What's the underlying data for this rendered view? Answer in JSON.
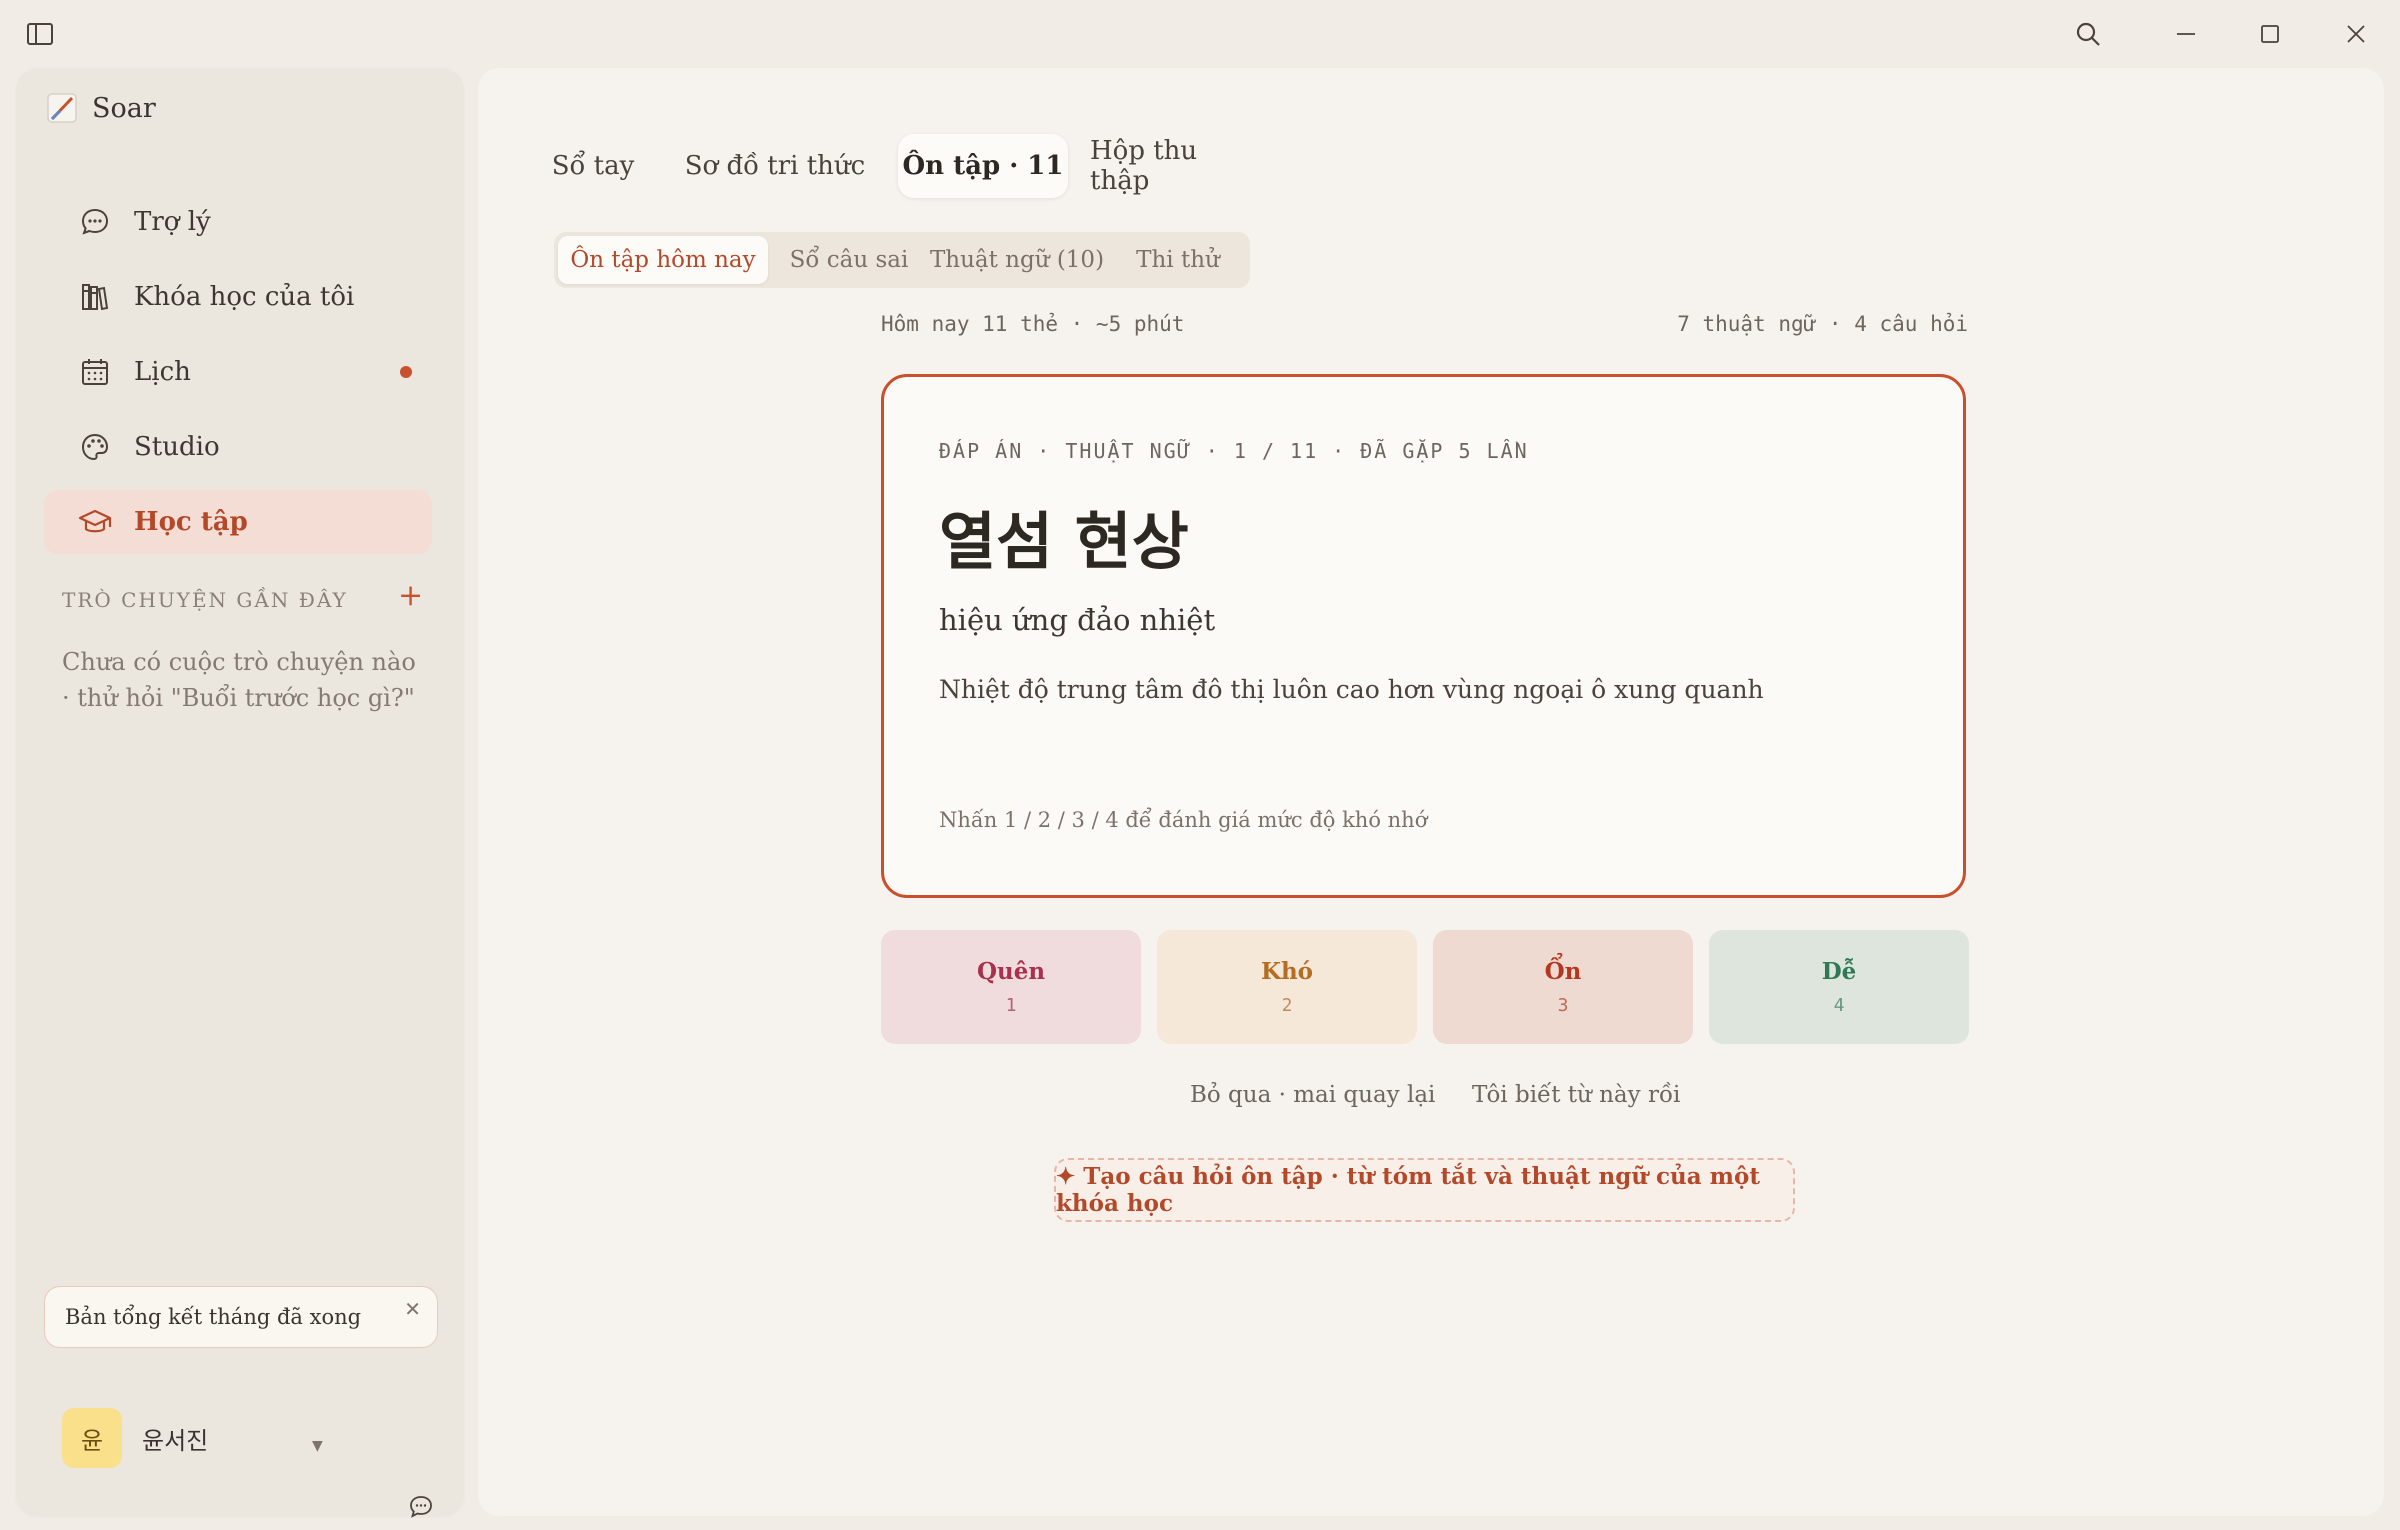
{
  "app": {
    "name": "Soar"
  },
  "sidebar": {
    "nav": [
      {
        "label": "Trợ lý",
        "icon": "chat-bubble-icon"
      },
      {
        "label": "Khóa học của tôi",
        "icon": "books-icon"
      },
      {
        "label": "Lịch",
        "icon": "calendar-icon",
        "badge": true
      },
      {
        "label": "Studio",
        "icon": "palette-icon"
      },
      {
        "label": "Học tập",
        "icon": "graduation-cap-icon",
        "active": true
      }
    ],
    "recent_heading": "TRÒ CHUYỆN GẦN ĐÂY",
    "recent_empty": "Chưa có cuộc trò chuyện nào · thử hỏi \"Buổi trước học gì?\"",
    "toast": "Bản tổng kết tháng đã xong",
    "user": {
      "avatar_text": "윤",
      "name": "윤서진"
    }
  },
  "tabs": [
    {
      "label": "Sổ tay"
    },
    {
      "label": "Sơ đồ tri thức"
    },
    {
      "label": "Ôn tập · 11",
      "active": true
    },
    {
      "label": "Hộp thu thập"
    }
  ],
  "subtabs": [
    {
      "label": "Ôn tập hôm nay",
      "active": true
    },
    {
      "label": "Sổ câu sai"
    },
    {
      "label": "Thuật ngữ (10)"
    },
    {
      "label": "Thi thử"
    }
  ],
  "review": {
    "summary_left": "Hôm nay 11 thẻ · ~5 phút",
    "summary_right": "7 thuật ngữ · 4 câu hỏi",
    "card": {
      "label": "ĐÁP ÁN · THUẬT NGỮ · 1 / 11 · ĐÃ GẶP 5 LẦN",
      "term": "열섬 현상",
      "meaning": "hiệu ứng đảo nhiệt",
      "description": "Nhiệt độ trung tâm đô thị luôn cao hơn vùng ngoại ô xung quanh",
      "hint": "Nhấn 1 / 2 / 3 / 4 để đánh giá mức độ khó nhớ"
    },
    "ratings": [
      {
        "label": "Quên",
        "key": "1",
        "bg": "#f0dcdc",
        "color": "#a8324e"
      },
      {
        "label": "Khó",
        "key": "2",
        "bg": "#f5e8d8",
        "color": "#b56d22"
      },
      {
        "label": "Ổn",
        "key": "3",
        "bg": "#eedad0",
        "color": "#b4361e"
      },
      {
        "label": "Dễ",
        "key": "4",
        "bg": "#dde5dc",
        "color": "#2f7a55"
      }
    ],
    "skip_link": "Bỏ qua · mai quay lại",
    "known_link": "Tôi biết từ này rồi",
    "generate_button": "✦ Tạo câu hỏi ôn tập · từ tóm tắt và thuật ngữ của một khóa học"
  },
  "colors": {
    "accent": "#c8502c",
    "background": "#f1ede6",
    "panel": "#f6f3ee"
  }
}
